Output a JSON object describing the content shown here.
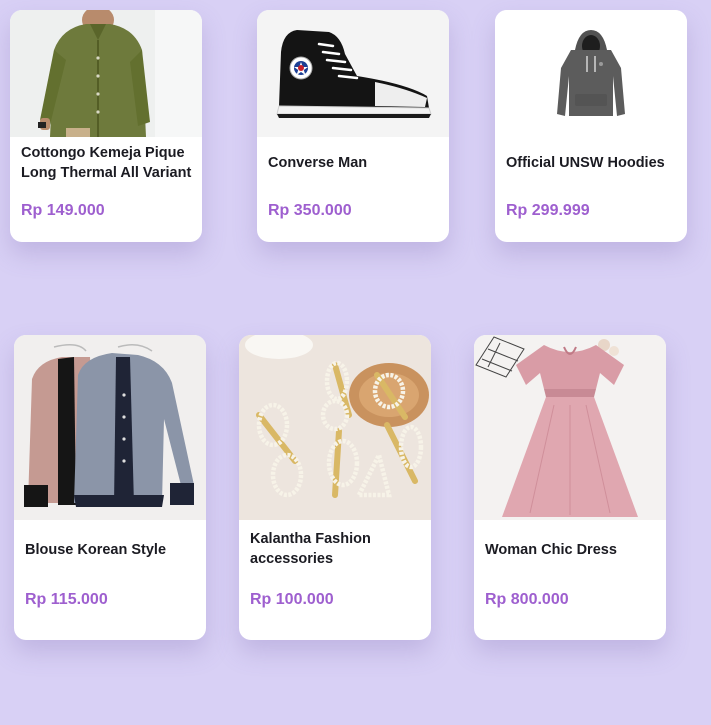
{
  "accent_color": "#9e5fcf",
  "background_color": "#d8d0f5",
  "products": [
    {
      "name": "Cottongo Kemeja Pique Long Thermal All Variant",
      "price": "Rp 149.000",
      "image": "olive-shirt-image"
    },
    {
      "name": "Converse Man",
      "price": "Rp 350.000",
      "image": "converse-sneaker-image"
    },
    {
      "name": "Official UNSW Hoodies",
      "price": "Rp 299.999",
      "image": "grey-hoodie-image"
    },
    {
      "name": "Blouse Korean Style",
      "price": "Rp 115.000",
      "image": "korean-blouse-image"
    },
    {
      "name": "Kalantha Fashion accessories",
      "price": "Rp 100.000",
      "image": "pearl-hairclips-image"
    },
    {
      "name": "Woman Chic Dress",
      "price": "Rp 800.000",
      "image": "pink-dress-image"
    }
  ]
}
